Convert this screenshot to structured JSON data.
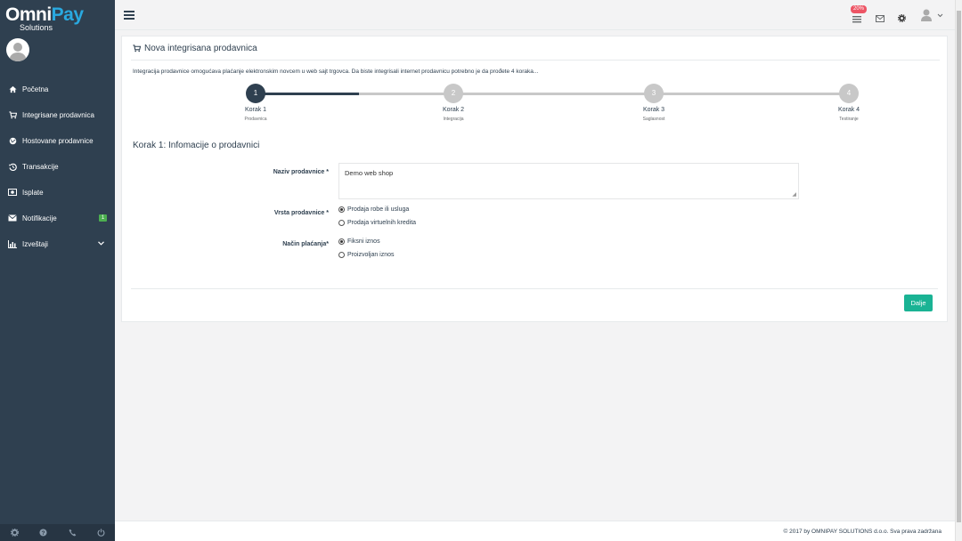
{
  "brand": {
    "name_part1": "Omni",
    "name_part2": "Pay",
    "sub": "Solutions"
  },
  "sidebar": {
    "items": [
      {
        "label": "Početna",
        "icon": "home-icon"
      },
      {
        "label": "Integrisane prodavnica",
        "icon": "cart-icon"
      },
      {
        "label": "Hostovane prodavnice",
        "icon": "globe-icon"
      },
      {
        "label": "Transakcije",
        "icon": "history-icon"
      },
      {
        "label": "Isplate",
        "icon": "money-icon"
      },
      {
        "label": "Notifikacije",
        "icon": "envelope-icon",
        "badge": "1"
      },
      {
        "label": "Izveštaji",
        "icon": "bar-chart-icon"
      }
    ]
  },
  "topbar": {
    "notif_badge": "20%"
  },
  "panel": {
    "title": "Nova integrisana prodavnica",
    "intro": "Integracija prodavnice omogućava plaćanje elektronskim novcem u web sajt trgovca. Da biste integrisali internet prodavnicu potrebno je da prođete 4 koraka..."
  },
  "steps": [
    {
      "num": "1",
      "label": "Korak 1",
      "sub": "Prodavnica"
    },
    {
      "num": "2",
      "label": "Korak 2",
      "sub": "Integracija"
    },
    {
      "num": "3",
      "label": "Korak 3",
      "sub": "Saglasnost"
    },
    {
      "num": "4",
      "label": "Korak 4",
      "sub": "Testiranje"
    }
  ],
  "form": {
    "section_title": "Korak 1: Infomacije o prodavnici",
    "name_label": "Naziv prodavnice *",
    "name_value": "Demo web shop",
    "type_label": "Vrsta prodavnice *",
    "type_options": [
      "Prodaja robe ili usluga",
      "Prodaja virtuelnih kredita"
    ],
    "payment_label": "Način plaćanja*",
    "payment_options": [
      "Fiksni iznos",
      "Proizvoljan iznos"
    ],
    "next_button": "Dalje"
  },
  "footer": {
    "text": "© 2017 by OMNIPAY SOLUTIONS d.o.o. Sva prava zadržana"
  },
  "colors": {
    "sidebar": "#2f4050",
    "accent": "#1ab394",
    "active_step": "#2f4050",
    "inactive_step": "#c8c8c8"
  }
}
